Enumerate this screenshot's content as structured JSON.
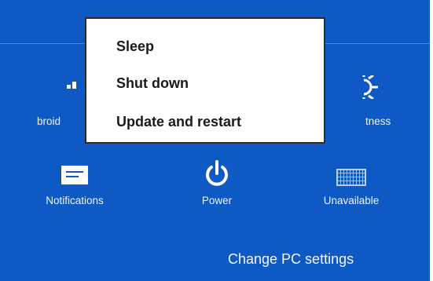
{
  "tiles": {
    "network_partial": "broid",
    "brightness_partial": "tness",
    "notifications": "Notifications",
    "power": "Power",
    "keyboard": "Unavailable"
  },
  "power_menu": {
    "items": [
      {
        "label": "Sleep"
      },
      {
        "label": "Shut down"
      },
      {
        "label": "Update and restart"
      }
    ]
  },
  "footer": {
    "change_pc_settings": "Change PC settings"
  },
  "icons": {
    "network": "signal-bars-icon",
    "brightness": "sun-icon",
    "notifications": "message-icon",
    "power": "power-icon",
    "keyboard": "keyboard-icon"
  },
  "colors": {
    "background": "#0f59c4",
    "menu_bg": "#ffffff",
    "text_light": "#ffffff"
  }
}
